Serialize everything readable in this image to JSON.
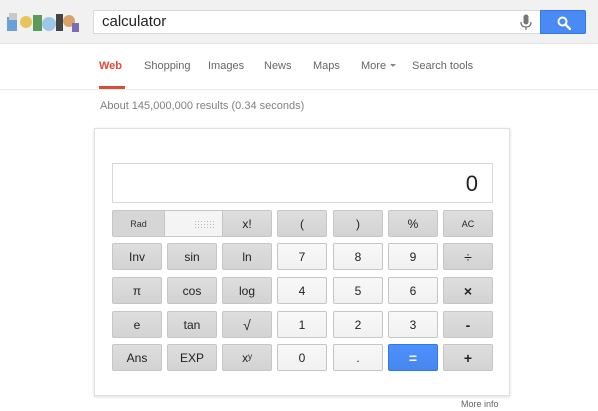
{
  "search": {
    "query": "calculator"
  },
  "tabs": [
    "Web",
    "Shopping",
    "Images",
    "News",
    "Maps",
    "More",
    "Search tools"
  ],
  "stats": "About 145,000,000 results (0.34 seconds)",
  "calculator": {
    "display": "0",
    "rad_label": "Rad",
    "rows": [
      [
        "x!",
        "(",
        ")",
        "%",
        "AC"
      ],
      [
        "Inv",
        "sin",
        "ln",
        "7",
        "8",
        "9",
        "÷"
      ],
      [
        "π",
        "cos",
        "log",
        "4",
        "5",
        "6",
        "×"
      ],
      [
        "e",
        "tan",
        "√",
        "1",
        "2",
        "3",
        "-"
      ],
      [
        "Ans",
        "EXP",
        "xʸ",
        "0",
        ".",
        "=",
        "+"
      ]
    ]
  },
  "footer": {
    "more_info": "More info"
  },
  "colors": {
    "accent_blue": "#4d90fe",
    "tab_red": "#dd4b39"
  },
  "icons": {
    "mic": "microphone-icon",
    "search": "search-icon",
    "logo": "google-doodle-logo"
  }
}
